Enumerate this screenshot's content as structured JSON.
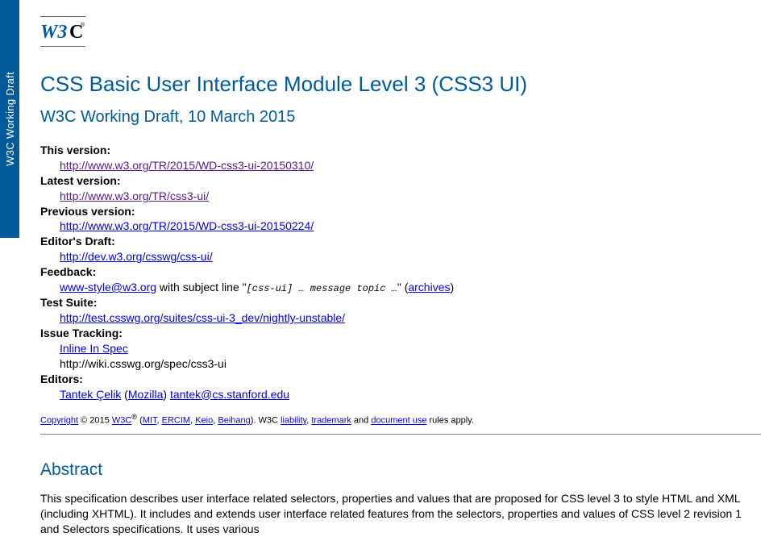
{
  "sidebar": {
    "label": "W3C Working Draft"
  },
  "logo": {
    "text": "W3C",
    "reg": "®"
  },
  "title": "CSS Basic User Interface Module Level 3 (CSS3 UI)",
  "subtitle": "W3C Working Draft, 10 March 2015",
  "meta": {
    "this_version": {
      "label": "This version:",
      "url": "http://www.w3.org/TR/2015/WD-css3-ui-20150310/"
    },
    "latest_version": {
      "label": "Latest version:",
      "url": "http://www.w3.org/TR/css3-ui/"
    },
    "previous_version": {
      "label": "Previous version:",
      "url": "http://www.w3.org/TR/2015/WD-css3-ui-20150224/"
    },
    "editors_draft": {
      "label": "Editor's Draft:",
      "url": "http://dev.w3.org/csswg/css-ui/"
    },
    "feedback": {
      "label": "Feedback:",
      "email": "www-style@w3.org",
      "text1": " with subject line \"",
      "code": "[css-ui] … message topic …",
      "text2": "\" (",
      "archives": "archives",
      "text3": ")"
    },
    "test_suite": {
      "label": "Test Suite:",
      "url": "http://test.csswg.org/suites/css-ui-3_dev/nightly-unstable/"
    },
    "issue_tracking": {
      "label": "Issue Tracking:",
      "inline": "Inline In Spec",
      "wiki": "http://wiki.csswg.org/spec/css3-ui"
    },
    "editors": {
      "label": "Editors:",
      "name": "Tantek Çelik",
      "lp": " (",
      "affil": "Mozilla",
      "rp": ") ",
      "email": "tantek@cs.stanford.edu"
    }
  },
  "copyright": {
    "link": "Copyright",
    "t1": " © 2015 ",
    "w3c": "W3C",
    "reg": "®",
    "t2": " (",
    "mit": "MIT",
    "c1": ", ",
    "ercim": "ERCIM",
    "c2": ", ",
    "keio": "Keio",
    "c3": ", ",
    "beihang": "Beihang",
    "t3": "). W3C ",
    "liability": "liability",
    "c4": ", ",
    "trademark": "trademark",
    "t4": " and ",
    "docuse": "document use",
    "t5": " rules apply."
  },
  "abstract": {
    "heading": "Abstract",
    "body": "This specification describes user interface related selectors, properties and values that are proposed for CSS level 3 to style HTML and XML (including XHTML). It includes and extends user interface related features from the selectors, properties and values of CSS level 2 revision 1 and Selectors specifications. It uses various"
  }
}
